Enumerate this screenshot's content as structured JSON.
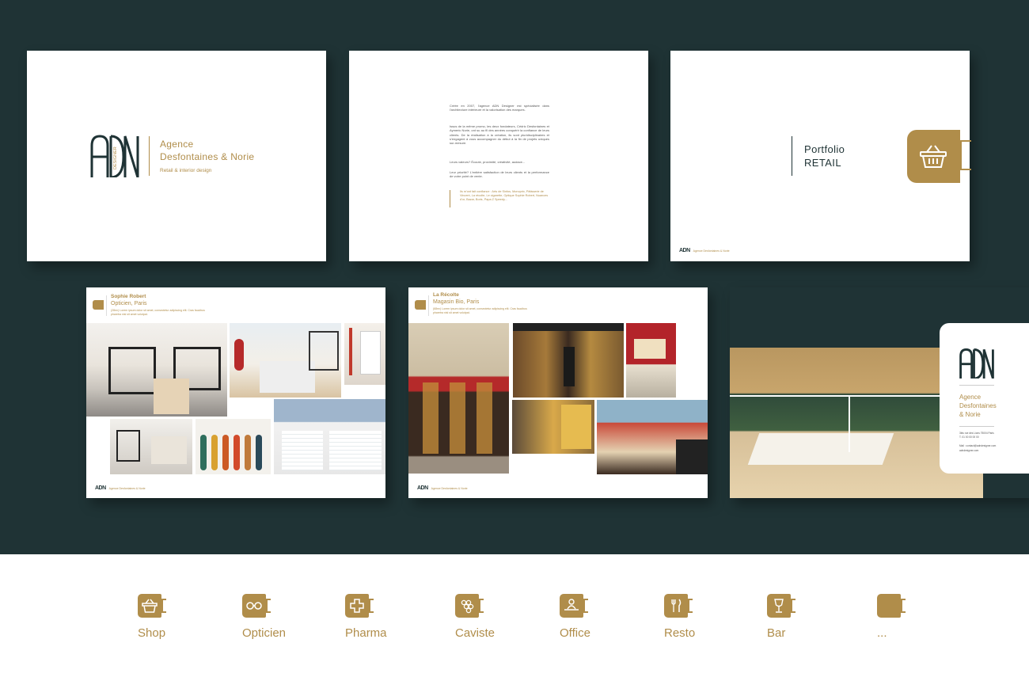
{
  "cover": {
    "logo_letters": "ADN",
    "logo_sub": "DESIGNER",
    "name_line1": "Agence",
    "name_line2": "Desfontaines & Norie",
    "tagline": "Retail & interior design"
  },
  "about": {
    "para1": "Créée en 2007, l'agence ADN Designer est spécialisée dans l'architecture intérieure et la valorisation des marques.",
    "para2": "Issus de la même promo, les deux fondateurs, Cédric Desfontaines et Aymeric Norie, ont su au fil des années conquérir la confiance de leurs clients. De la réalisation à la création, ils sont pluridisciplinaires et s'engagent à vous accompagner du début à la fin de projets uniques sur-mesure.",
    "para3": "Leurs valeurs? Écoute, proximité, créativité, audace...",
    "para4": "Leur priorité? L'entière satisfaction de leurs clients et la performance de votre point de vente.",
    "quote": "Ils m'ont fait confiance : Arts de Sinfos, Monoprix, Pâtisserie de Vincent, La récolte, Le cigarette, Optique Sophie Robert, Nuances d'or, Bazar, Boris, Papa Z Speedy..."
  },
  "portfolio": {
    "line1": "Portfolio",
    "line2": "RETAIL",
    "footer_logo": "ADN",
    "footer_text": "Agence Desfontaines & Norie"
  },
  "project1": {
    "title": "Sophie Robert",
    "subtitle": "Opticien, Paris",
    "desc": "(28m²) Lorem ipsum dolor sit amet, consectetur adipiscing elit. Cras faucibus pharetra nisl sit amet volutpat.",
    "footer_logo": "ADN",
    "footer_text": "Agence Desfontaines & Norie"
  },
  "project2": {
    "title": "La Récolte",
    "subtitle": "Magasin Bio, Paris",
    "desc": "(68m²) Lorem ipsum dolor sit amet, consectetur adipiscing elit. Cras faucibus pharetra nisl sit amet volutpat.",
    "footer_logo": "ADN",
    "footer_text": "Agence Desfontaines & Norie"
  },
  "contact": {
    "logo_letters": "ADN",
    "name": [
      "Agence",
      "Desfontaines",
      "& Norie"
    ],
    "address": "3bis rue des Lions 75004 Paris\nT. 01 00 00 00 00",
    "mail": "Mail : contact@adndesigner.com",
    "web": "adndesigner.com"
  },
  "categories": [
    {
      "label": "Shop",
      "icon": "basket-icon"
    },
    {
      "label": "Opticien",
      "icon": "glasses-icon"
    },
    {
      "label": "Pharma",
      "icon": "cross-icon"
    },
    {
      "label": "Caviste",
      "icon": "grapes-icon"
    },
    {
      "label": "Office",
      "icon": "person-desk-icon"
    },
    {
      "label": "Resto",
      "icon": "fork-knife-icon"
    },
    {
      "label": "Bar",
      "icon": "glass-icon"
    },
    {
      "label": "...",
      "icon": "blank-icon"
    }
  ],
  "colors": {
    "background": "#1f3335",
    "accent": "#b08d4a",
    "paper": "#ffffff"
  }
}
